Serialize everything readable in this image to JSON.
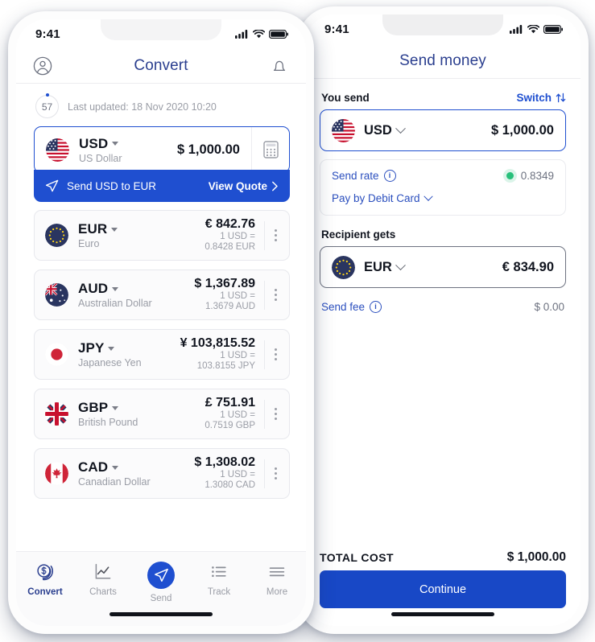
{
  "status_bar": {
    "time": "9:41"
  },
  "left_phone": {
    "nav": {
      "title": "Convert",
      "profile_icon": "person-circle-icon",
      "bell_icon": "bell-icon"
    },
    "updated": {
      "timer": "57",
      "text": "Last updated: 18 Nov 2020 10:20"
    },
    "main_card": {
      "flag": "us-flag",
      "code": "USD",
      "name": "US Dollar",
      "amount": "$ 1,000.00",
      "calculator_icon": "calculator-icon"
    },
    "banner": {
      "send_icon": "paper-plane-icon",
      "text": "Send USD to EUR",
      "cta": "View Quote",
      "chevron": "chevron-right-icon"
    },
    "currencies": [
      {
        "flag": "eu-flag",
        "code": "EUR",
        "name": "Euro",
        "amount": "€ 842.76",
        "rate_line1": "1 USD =",
        "rate_line2": "0.8428 EUR"
      },
      {
        "flag": "au-flag",
        "code": "AUD",
        "name": "Australian Dollar",
        "amount": "$ 1,367.89",
        "rate_line1": "1 USD =",
        "rate_line2": "1.3679 AUD"
      },
      {
        "flag": "jp-flag",
        "code": "JPY",
        "name": "Japanese Yen",
        "amount": "¥ 103,815.52",
        "rate_line1": "1 USD =",
        "rate_line2": "103.8155 JPY"
      },
      {
        "flag": "gb-flag",
        "code": "GBP",
        "name": "British Pound",
        "amount": "£ 751.91",
        "rate_line1": "1 USD =",
        "rate_line2": "0.7519 GBP"
      },
      {
        "flag": "ca-flag",
        "code": "CAD",
        "name": "Canadian Dollar",
        "amount": "$ 1,308.02",
        "rate_line1": "1 USD =",
        "rate_line2": "1.3080 CAD"
      }
    ],
    "tabs": [
      {
        "label": "Convert",
        "icon": "coins-icon",
        "active": true
      },
      {
        "label": "Charts",
        "icon": "line-chart-icon",
        "active": false
      },
      {
        "label": "Send",
        "icon": "paper-plane-icon",
        "active": false
      },
      {
        "label": "Track",
        "icon": "list-icon",
        "active": false
      },
      {
        "label": "More",
        "icon": "hamburger-icon",
        "active": false
      }
    ]
  },
  "right_phone": {
    "nav": {
      "title": "Send money"
    },
    "you_send": {
      "label": "You send",
      "switch_label": "Switch",
      "switch_icon": "swap-vertical-icon",
      "flag": "us-flag",
      "code": "USD",
      "amount": "$ 1,000.00"
    },
    "rate_card": {
      "send_rate_label": "Send rate",
      "send_rate_info_icon": "info-icon",
      "send_rate_value": "0.8349",
      "status_dot_color": "#28c07b",
      "pay_method": "Pay by Debit Card",
      "pay_method_chevron": "chevron-down-icon"
    },
    "recipient": {
      "label": "Recipient gets",
      "flag": "eu-flag",
      "code": "EUR",
      "amount": "€ 834.90"
    },
    "fee": {
      "label": "Send fee",
      "info_icon": "info-icon",
      "value": "$ 0.00"
    },
    "total": {
      "label": "TOTAL COST",
      "value": "$ 1,000.00"
    },
    "cta": {
      "label": "Continue"
    }
  },
  "colors": {
    "brand_blue": "#1f4fd0",
    "cta_blue": "#1848c6",
    "title_navy": "#2b3f8f",
    "muted": "#9a9da6",
    "green": "#28c07b"
  }
}
